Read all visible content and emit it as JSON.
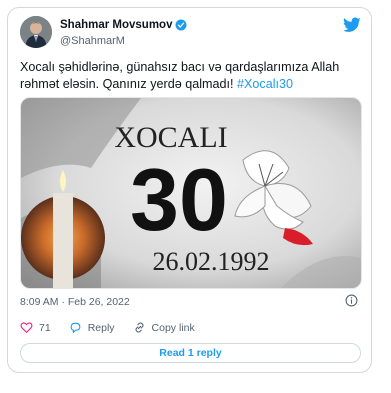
{
  "tweet": {
    "author_name": "Shahmar Movsumov",
    "author_handle": "@ShahmarM",
    "text_main": "Xocalı şəhidlərinə, günahsız bacı və qardaşlarımıza Allah rəhmət eləsin. Qanınız yerdə qalmadı! ",
    "hashtag": "#Xocalı30",
    "time": "8:09 AM · Feb 26, 2022",
    "likes": "71",
    "reply_label": "Reply",
    "copy_link_label": "Copy link",
    "read_replies_label": "Read 1 reply"
  },
  "media": {
    "heading": "XOCALI",
    "number": "30",
    "date": "26.02.1992"
  },
  "colors": {
    "accent": "#1d9bf0",
    "text": "#0f1419",
    "muted": "#536471",
    "border": "#cfd9de"
  },
  "icons": [
    "verified-badge-icon",
    "twitter-bird-icon",
    "info-icon",
    "heart-icon",
    "reply-icon",
    "link-icon"
  ]
}
